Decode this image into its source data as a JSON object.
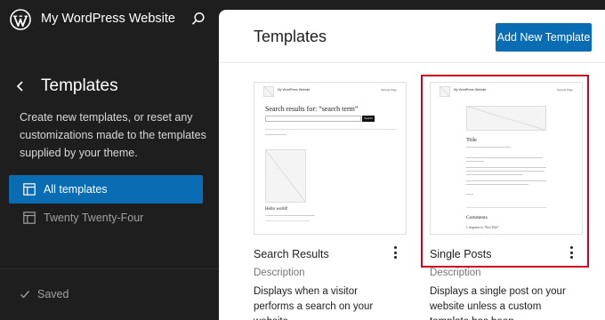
{
  "site": {
    "title": "My WordPress Website"
  },
  "sidebar": {
    "title": "Templates",
    "description": "Create new templates, or reset any customizations made to the templates supplied by your theme.",
    "items": [
      {
        "label": "All templates",
        "active": true
      },
      {
        "label": "Twenty Twenty-Four",
        "active": false
      }
    ],
    "status": "Saved"
  },
  "main": {
    "title": "Templates",
    "add_button": "Add New Template",
    "cards": [
      {
        "name": "Search Results",
        "description_label": "Description",
        "description": "Displays when a visitor performs a search on your website.",
        "preview": {
          "site": "My WordPress Website",
          "nav": "Sample Page",
          "heading": "Search results for: “search term”",
          "search_btn": "Search",
          "post_title": "Hello world!"
        }
      },
      {
        "name": "Single Posts",
        "description_label": "Description",
        "description": "Displays a single post on your website unless a custom template has been",
        "preview": {
          "site": "My WordPress Website",
          "nav": "Sample Page",
          "heading": "Title",
          "comments_heading": "Comments",
          "comments_sub": "1 response to “Post Title”"
        }
      }
    ]
  },
  "colors": {
    "accent": "#0a6db3",
    "highlight": "#d0021b",
    "sidebar_bg": "#1e1e1e"
  }
}
